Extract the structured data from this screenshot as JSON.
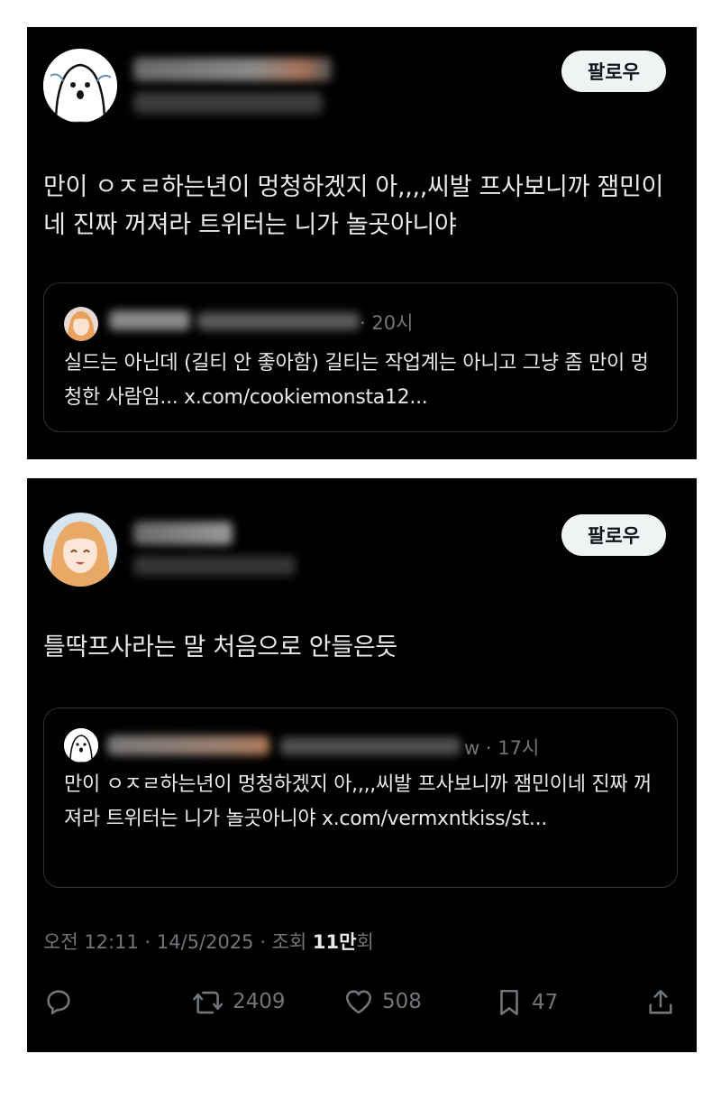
{
  "tweet1": {
    "follow_label": "팔로우",
    "text": "만이 ㅇㅈㄹ하는년이 멍청하겠지 아,,,,씨발 프사보니까 잼민이네 진짜 꺼져라 트위터는 니가 놀곳아니야",
    "quote": {
      "time": "20시",
      "text": "실드는 아닌데 (길티 안 좋아함) 길티는 작업계는 아니고 그냥 좀 만이 멍청한 사람임... x.com/cookiemonsta12..."
    }
  },
  "tweet2": {
    "follow_label": "팔로우",
    "text": "틀딱프사라는 말 처음으로 안들은듯",
    "quote": {
      "handle_tail": "w",
      "time": "17시",
      "text": "만이 ㅇㅈㄹ하는년이 멍청하겠지 아,,,,씨발 프사보니까 잼민이네 진짜 꺼져라 트위터는 니가 놀곳아니야 x.com/vermxntkiss/st..."
    },
    "meta": {
      "time_date": "오전 12:11 · 14/5/2025 · 조회 ",
      "views": "11만",
      "views_suffix": "회"
    },
    "actions": {
      "reply_icon": "reply-icon",
      "retweet_icon": "retweet-icon",
      "retweets": "2409",
      "like_icon": "heart-icon",
      "likes": "508",
      "bookmark_icon": "bookmark-icon",
      "bookmarks": "47",
      "share_icon": "share-icon"
    }
  }
}
